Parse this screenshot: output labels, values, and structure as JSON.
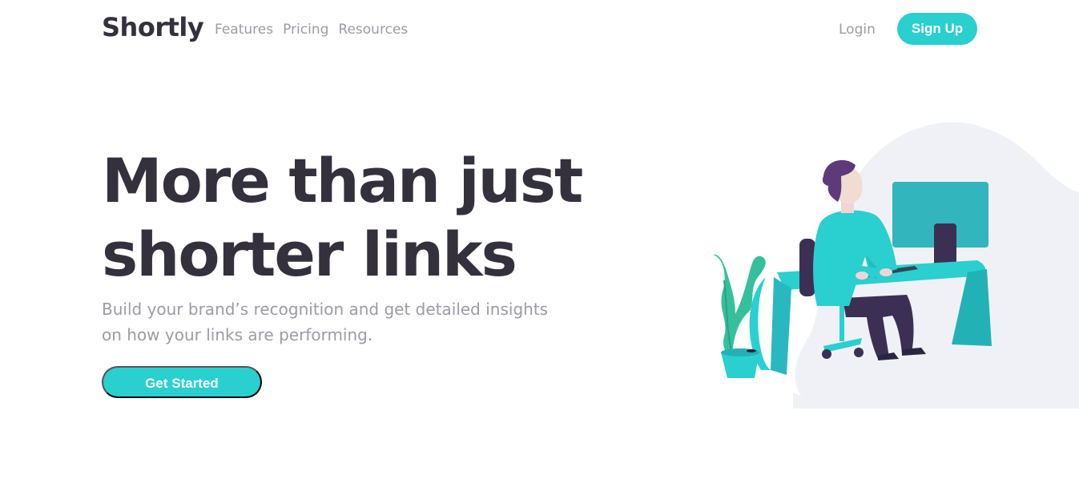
{
  "header": {
    "logo": "Shortly",
    "nav": [
      {
        "label": "Features"
      },
      {
        "label": "Pricing"
      },
      {
        "label": "Resources"
      }
    ],
    "login_label": "Login",
    "signup_label": "Sign Up"
  },
  "hero": {
    "title_line1": "More than just",
    "title_line2": "shorter links",
    "subtitle": "Build your brand’s recognition and get detailed insights on how your links are performing.",
    "cta_label": "Get Started"
  },
  "colors": {
    "primary_cyan": "#2acfcf",
    "dark_text": "#34313d",
    "gray_text": "#9e9aa7",
    "blob_bg": "#f0f1f6"
  }
}
